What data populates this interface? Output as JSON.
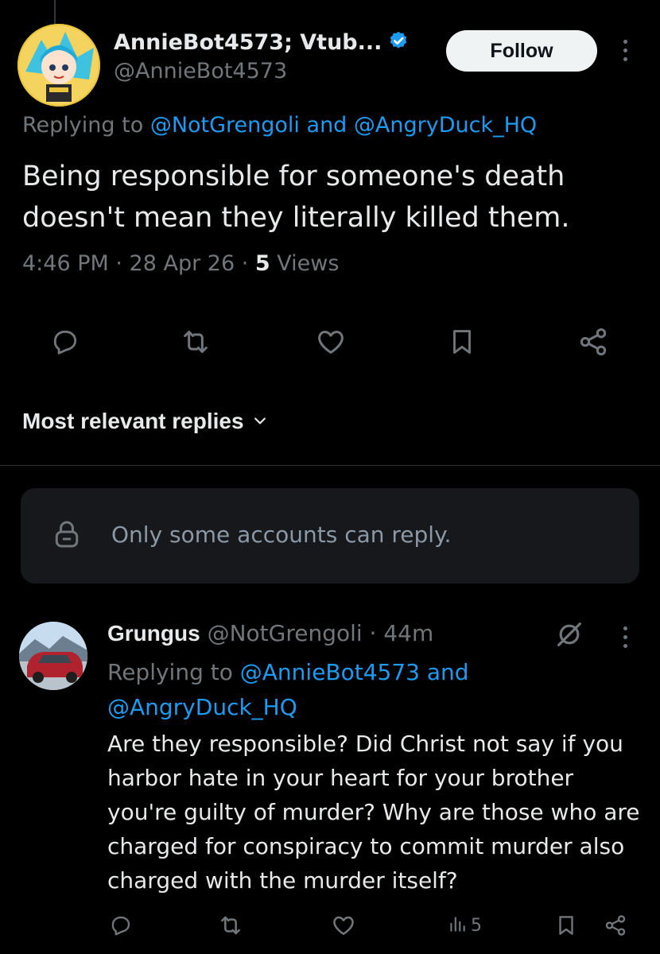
{
  "tweet": {
    "author_name": "AnnieBot4573; Vtub...",
    "handle": "@AnnieBot4573",
    "follow_label": "Follow",
    "replying_prefix": "Replying to ",
    "replying_user1": "@NotGrengoli",
    "replying_and": " and ",
    "replying_user2": "@AngryDuck_HQ",
    "text": "Being responsible for someone's death doesn't mean they literally killed them.",
    "time": "4:46 PM",
    "sep1": " · ",
    "date": "28 Apr 26",
    "sep2": " · ",
    "views_count": "5",
    "views_label": " Views"
  },
  "replies_section": {
    "sort_label": "Most relevant replies",
    "restriction_text": "Only some accounts can reply."
  },
  "reply": {
    "author_name": "Grungus",
    "handle": " @NotGrengoli",
    "sep": " · ",
    "time": "44m",
    "replying_prefix": "Replying to ",
    "replying_user1": "@AnnieBot4573",
    "replying_and": " and",
    "replying_user2": "@AngryDuck_HQ",
    "text": "Are they responsible?  Did Christ not say if you harbor hate in your heart for your brother you're guilty of murder?  Why are those who are charged for conspiracy to commit murder also charged with the murder itself?",
    "views_count": "5"
  },
  "icons": {
    "reply": "reply-icon",
    "retweet": "retweet-icon",
    "like": "heart-icon",
    "bookmark": "bookmark-icon",
    "share": "share-icon",
    "views": "views-icon",
    "lock": "lock-icon",
    "grok": "grok-icon",
    "verified": "verified-badge-icon"
  },
  "colors": {
    "background": "#000000",
    "text": "#e7e9ea",
    "muted": "#71767b",
    "link": "#1d9bf0",
    "follow_button": "#eff3f4"
  }
}
